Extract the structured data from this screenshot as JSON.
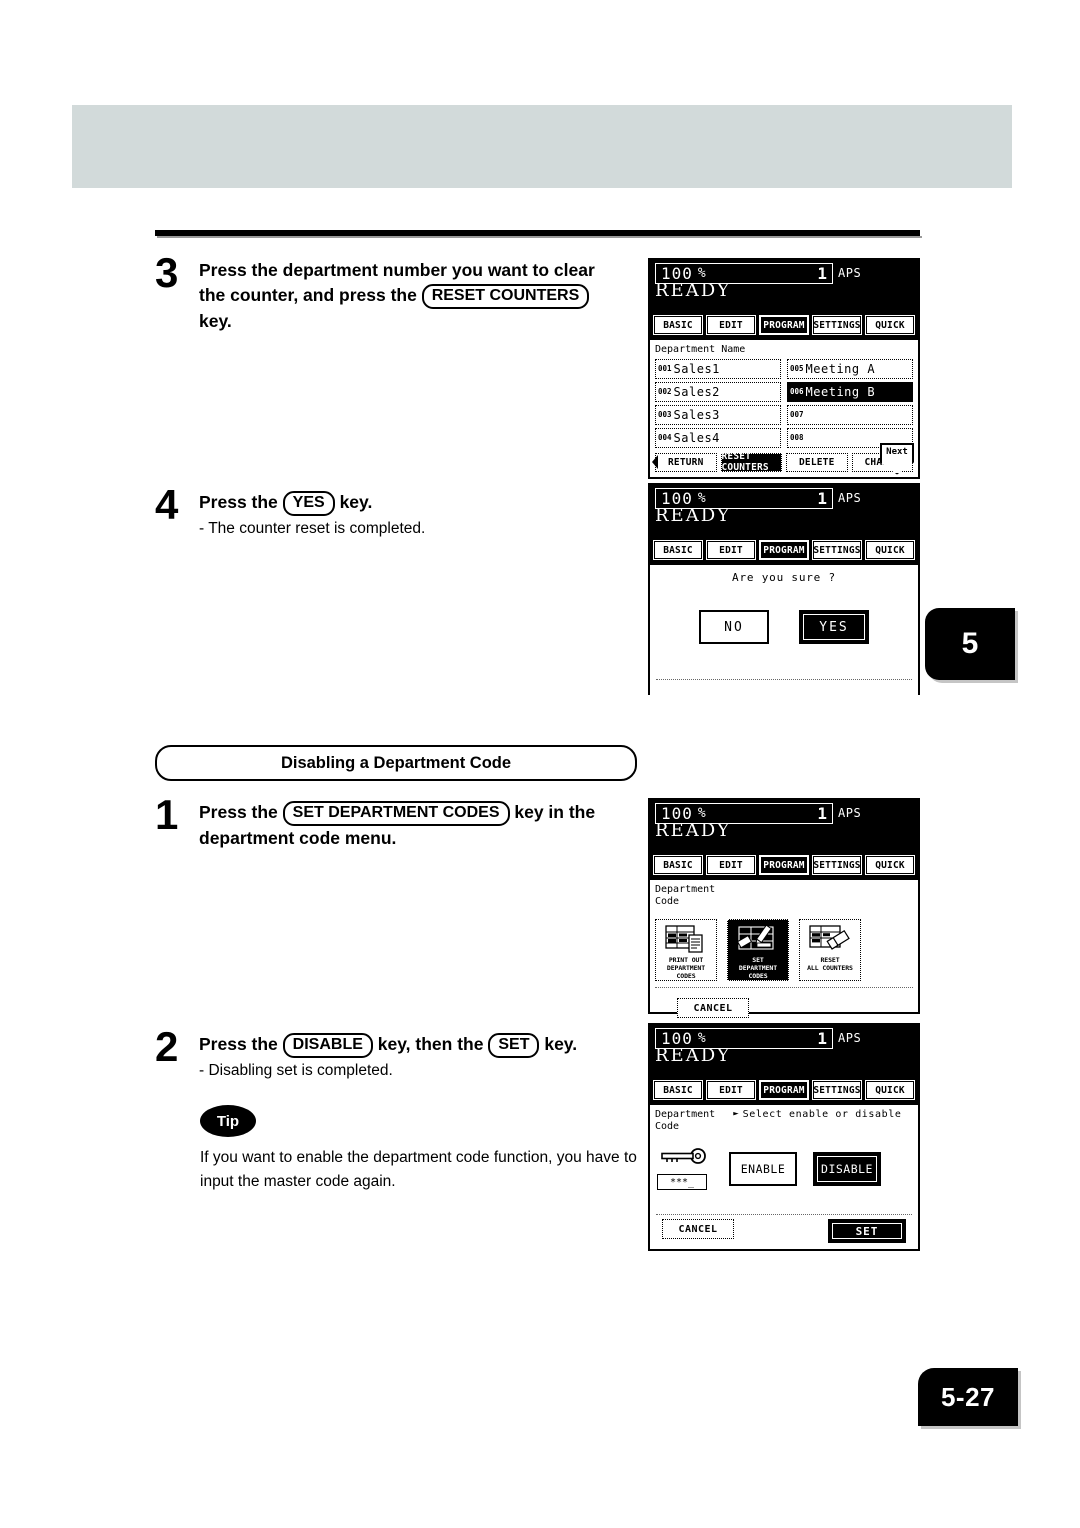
{
  "page": {
    "number": "5-27",
    "chapter": "5"
  },
  "section": {
    "heading": "Disabling a Department Code"
  },
  "steps": {
    "step3": {
      "num": "3",
      "line1_a": "Press the department number you want to clear",
      "line2_a": "the counter, and press the",
      "key": "RESET COUNTERS",
      "line3": "key."
    },
    "step4": {
      "num": "4",
      "title_a": "Press the",
      "key": "YES",
      "title_b": "key.",
      "sub": "-  The counter reset is completed."
    },
    "step1": {
      "num": "1",
      "line1_a": "Press the",
      "key": "SET DEPARTMENT CODES",
      "line1_b": "key in the",
      "line2": "department code menu."
    },
    "step2": {
      "num": "2",
      "title_a": "Press the",
      "key1": "DISABLE",
      "title_b": "key, then the",
      "key2": "SET",
      "title_c": "key.",
      "sub": "-  Disabling set is completed."
    }
  },
  "tip": {
    "badge": "Tip",
    "text": "If you want to enable the department code function, you have to input the master code again."
  },
  "lcd_common": {
    "zoom": "100",
    "percent_symbol": "%",
    "copies": "1",
    "paper_mode": "APS",
    "status": "READY",
    "tabs": [
      {
        "label": "BASIC",
        "selected": false
      },
      {
        "label": "EDIT",
        "selected": false
      },
      {
        "label": "PROGRAM",
        "selected": true
      },
      {
        "label": "SETTINGS",
        "selected": false
      },
      {
        "label": "QUICK",
        "selected": false
      }
    ]
  },
  "panel1": {
    "list_title": "Department Name",
    "departments": [
      {
        "code": "001",
        "name": "Sales1",
        "selected": false
      },
      {
        "code": "005",
        "name": "Meeting A",
        "selected": false
      },
      {
        "code": "002",
        "name": "Sales2",
        "selected": false
      },
      {
        "code": "006",
        "name": "Meeting B",
        "selected": true
      },
      {
        "code": "003",
        "name": "Sales3",
        "selected": false
      },
      {
        "code": "007",
        "name": "",
        "selected": false
      },
      {
        "code": "004",
        "name": "Sales4",
        "selected": false
      },
      {
        "code": "008",
        "name": "",
        "selected": false
      }
    ],
    "next_label": "Next",
    "footer_buttons": [
      {
        "label": "RETURN",
        "selected": false
      },
      {
        "label": "RESET COUNTERS",
        "selected": true
      },
      {
        "label": "DELETE",
        "selected": false
      },
      {
        "label": "CHANGE",
        "selected": false
      }
    ]
  },
  "panel2": {
    "question": "Are you sure ?",
    "buttons": [
      {
        "label": "NO",
        "selected": false
      },
      {
        "label": "YES",
        "selected": true
      }
    ]
  },
  "panel3": {
    "label_line1": "Department",
    "label_line2": "Code",
    "menu_items": [
      {
        "cap1": "PRINT OUT",
        "cap2": "DEPARTMENT CODES",
        "icon": "printout-department-codes-icon",
        "selected": false
      },
      {
        "cap1": "SET",
        "cap2": "DEPARTMENT CODES",
        "icon": "set-department-codes-icon",
        "selected": true
      },
      {
        "cap1": "RESET",
        "cap2": "ALL COUNTERS",
        "icon": "reset-all-counters-icon",
        "selected": false
      }
    ],
    "cancel_label": "CANCEL"
  },
  "panel4": {
    "label_line1": "Department",
    "label_line2": "Code",
    "hint": "Select enable or disable",
    "password_mask": "***_",
    "buttons": [
      {
        "label": "ENABLE",
        "selected": false
      },
      {
        "label": "DISABLE",
        "selected": true
      }
    ],
    "cancel_label": "CANCEL",
    "set_label": "SET"
  }
}
